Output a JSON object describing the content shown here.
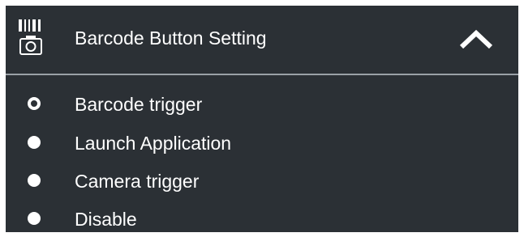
{
  "header": {
    "title": "Barcode Button Setting",
    "icon": "barcode-camera-icon",
    "toggle_icon": "chevron-up-icon"
  },
  "options": [
    {
      "label": "Barcode trigger",
      "selected": true
    },
    {
      "label": "Launch Application",
      "selected": false
    },
    {
      "label": "Camera trigger",
      "selected": false
    },
    {
      "label": "Disable",
      "selected": false
    }
  ],
  "colors": {
    "panel_background": "#2b3035",
    "text": "#ffffff",
    "divider": "#9aa1a7"
  }
}
